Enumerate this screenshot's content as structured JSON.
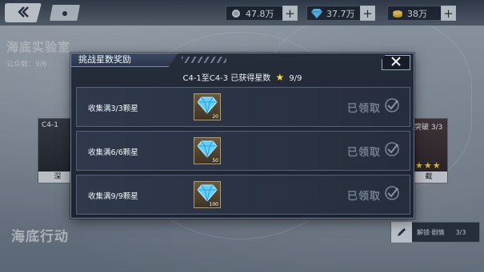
{
  "top_bar": {
    "resources": [
      {
        "icon": "silver-coin-icon",
        "value": "47.8万"
      },
      {
        "icon": "diamond-icon",
        "value": "37.7万"
      },
      {
        "icon": "gold-coin-icon",
        "value": "38万"
      }
    ]
  },
  "background": {
    "title": "海底实验室",
    "sub": "公众数：9/6",
    "area_title": "海底行动",
    "left_card": {
      "label": "C4-1",
      "foot": "深"
    },
    "right_card": {
      "label": "突破 3/3",
      "foot": "截"
    },
    "unlock_label": "解锁·剧情",
    "unlock_count": "3/3"
  },
  "modal": {
    "tab_title": "挑战星数奖励",
    "summary_text": "C4-1至C4-3 已获得星数",
    "summary_star": "★",
    "summary_count": "9/9",
    "claimed_label": "已领取",
    "rows": [
      {
        "requirement": "收集满3/3颗星",
        "reward_icon": "diamond-icon",
        "amount": "20"
      },
      {
        "requirement": "收集满6/6颗星",
        "reward_icon": "diamond-icon",
        "amount": "50"
      },
      {
        "requirement": "收集满9/9颗星",
        "reward_icon": "diamond-icon",
        "amount": "100"
      }
    ]
  },
  "colors": {
    "accent_star": "#ffd83b",
    "modal_bg": "#1d2431",
    "diamond": "#5fd0ff"
  }
}
